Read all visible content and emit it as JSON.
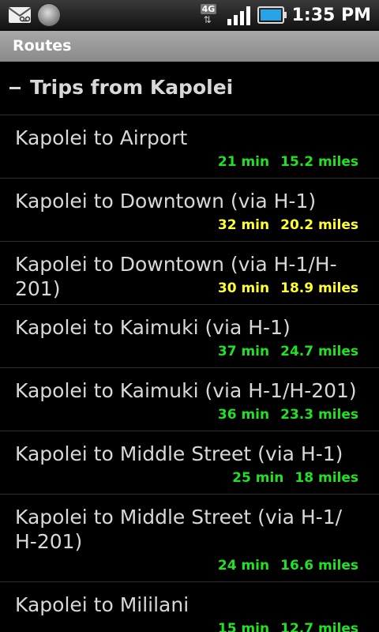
{
  "status_bar": {
    "time": "1:35 PM",
    "network": "4G",
    "network_arrows": "⇅"
  },
  "title_bar": {
    "title": "Routes"
  },
  "group": {
    "title": "Trips from Kapolei"
  },
  "colors": {
    "green": "#22e022",
    "yellow": "#ffff33"
  },
  "routes": [
    {
      "name": "Kapolei to Airport",
      "time": "21 min",
      "distance": "15.2 miles",
      "color": "green"
    },
    {
      "name": "Kapolei to Downtown (via H-1)",
      "time": "32 min",
      "distance": "20.2 miles",
      "color": "yellow"
    },
    {
      "name": "Kapolei to Downtown (via H-1/H-201)",
      "time": "30 min",
      "distance": "18.9 miles",
      "color": "yellow"
    },
    {
      "name": "Kapolei to Kaimuki (via H-1)",
      "time": "37 min",
      "distance": "24.7 miles",
      "color": "green"
    },
    {
      "name": "Kapolei to Kaimuki (via H-1/H-201)",
      "time": "36 min",
      "distance": "23.3 miles",
      "color": "green"
    },
    {
      "name": "Kapolei to Middle Street (via H-1)",
      "time": "25 min",
      "distance": "18 miles",
      "color": "green"
    },
    {
      "name": "Kapolei to Middle Street (via H-1/\nH-201)",
      "time": "24 min",
      "distance": "16.6 miles",
      "color": "green"
    },
    {
      "name": "Kapolei to Mililani",
      "time": "15 min",
      "distance": "12.7 miles",
      "color": "green"
    }
  ]
}
